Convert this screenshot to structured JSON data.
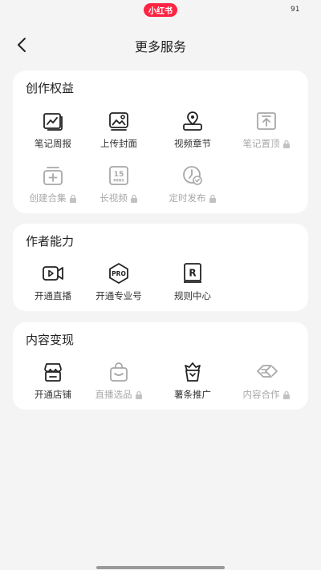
{
  "status": {
    "app_badge": "小红书",
    "battery": "91"
  },
  "nav": {
    "title": "更多服务"
  },
  "sections": {
    "creation": {
      "title": "创作权益",
      "items": [
        {
          "label": "笔记周报",
          "icon": "note-report-icon",
          "disabled": false
        },
        {
          "label": "上传封面",
          "icon": "upload-cover-icon",
          "disabled": false
        },
        {
          "label": "视频章节",
          "icon": "video-chapter-icon",
          "disabled": false
        },
        {
          "label": "笔记置顶",
          "icon": "pin-note-icon",
          "disabled": true
        },
        {
          "label": "创建合集",
          "icon": "create-collection-icon",
          "disabled": true
        },
        {
          "label": "长视频",
          "icon": "long-video-icon",
          "disabled": true
        },
        {
          "label": "定时发布",
          "icon": "scheduled-publish-icon",
          "disabled": true
        }
      ]
    },
    "author": {
      "title": "作者能力",
      "items": [
        {
          "label": "开通直播",
          "icon": "live-stream-icon",
          "disabled": false
        },
        {
          "label": "开通专业号",
          "icon": "pro-account-icon",
          "disabled": false
        },
        {
          "label": "规则中心",
          "icon": "rules-center-icon",
          "disabled": false
        }
      ]
    },
    "monetize": {
      "title": "内容变现",
      "items": [
        {
          "label": "开通店铺",
          "icon": "open-store-icon",
          "disabled": false
        },
        {
          "label": "直播选品",
          "icon": "live-selection-icon",
          "disabled": true
        },
        {
          "label": "薯条推广",
          "icon": "promotion-icon",
          "disabled": false
        },
        {
          "label": "内容合作",
          "icon": "content-cooperation-icon",
          "disabled": true
        }
      ]
    }
  },
  "icon_text": {
    "long_video_top": "15",
    "long_video_bottom": "MINS",
    "pro": "PRO",
    "rules": "R"
  },
  "colors": {
    "brand": "#ff2442",
    "active_icon": "#222222",
    "disabled_icon": "#a8a8a8"
  }
}
